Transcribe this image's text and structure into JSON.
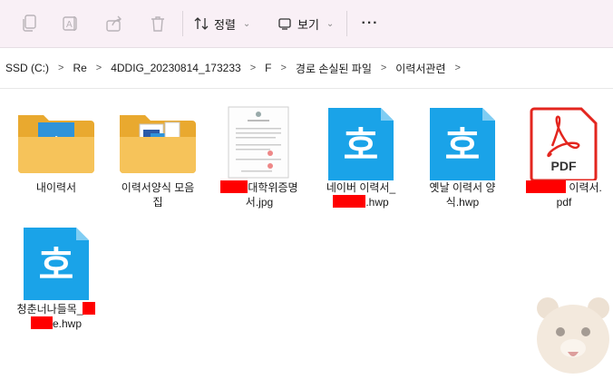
{
  "toolbar": {
    "sort_label": "정렬",
    "view_label": "보기",
    "more_label": "···"
  },
  "breadcrumb": [
    "SSD (C:)",
    "Re",
    "4DDIG_20230814_173233",
    "F",
    "경로 손실된 파일",
    "이력서관련"
  ],
  "files": [
    {
      "name_line1": "내이력서",
      "type": "folder"
    },
    {
      "name_line1": "이력서양식 모음",
      "name_line2": "집",
      "type": "folder"
    },
    {
      "name_line1_suffix": "대학위증명",
      "name_line2": "서.jpg",
      "type": "jpg"
    },
    {
      "name_line1": "네이버 이력서_",
      "name_line2_suffix": ".hwp",
      "type": "hwp"
    },
    {
      "name_line1": "옛날 이력서 양",
      "name_line2": "식.hwp",
      "type": "hwp"
    },
    {
      "name_line1_suffix": " 이력서.",
      "name_line2": "pdf",
      "type": "pdf",
      "pdf_text": "PDF"
    },
    {
      "name_line1": "청춘너나들목_",
      "name_line2_suffix": "e.hwp",
      "type": "hwp"
    }
  ],
  "hwp_glyph": "호",
  "colors": {
    "accent": "#1aa3e8",
    "pdf_red": "#e3261f",
    "folder": "#f6c35a",
    "redaction": "#ff0000"
  }
}
